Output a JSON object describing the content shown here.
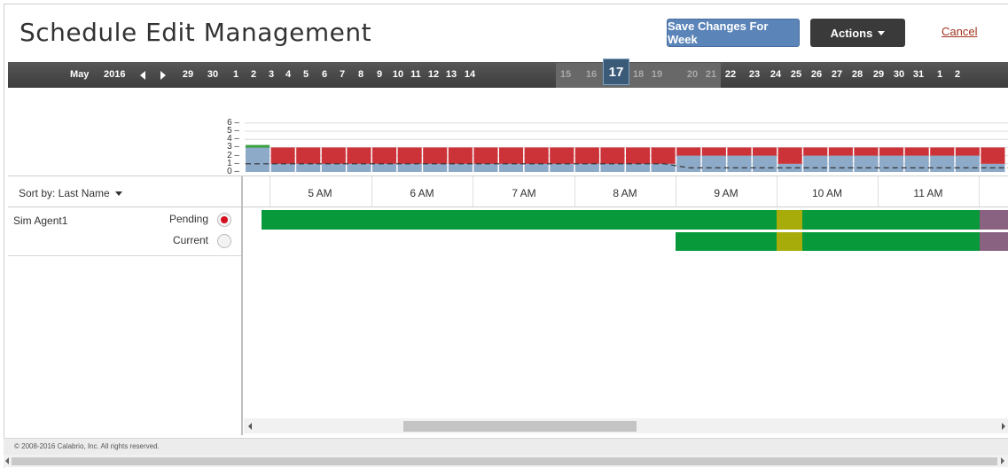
{
  "header": {
    "title": "Schedule Edit Management",
    "save_label": "Save Changes For Week",
    "actions_label": "Actions",
    "cancel_label": "Cancel"
  },
  "date_strip": {
    "month": "May",
    "year": "2016",
    "selected_day": "17",
    "days": [
      "29",
      "30",
      "1",
      "2",
      "3",
      "4",
      "5",
      "6",
      "7",
      "8",
      "9",
      "10",
      "11",
      "12",
      "13",
      "14",
      "15",
      "16",
      "18",
      "19",
      "20",
      "21",
      "22",
      "23",
      "24",
      "25",
      "26",
      "27",
      "28",
      "29",
      "30",
      "31",
      "1",
      "2"
    ],
    "dim_days": [
      "15",
      "16",
      "18",
      "19",
      "20",
      "21"
    ]
  },
  "coverage_chart": {
    "type": "bar",
    "y_ticks": [
      "6",
      "5",
      "4",
      "3",
      "2",
      "1",
      "0"
    ],
    "ylim": [
      0,
      6
    ],
    "bar_count": 30,
    "scheduled_values": [
      3,
      1,
      1,
      1,
      1,
      1,
      1,
      1,
      1,
      1,
      1,
      1,
      1,
      1,
      1,
      1,
      1,
      2,
      2,
      2,
      2,
      1,
      2,
      2,
      2,
      2,
      2,
      2,
      2,
      1
    ],
    "required_values": [
      3,
      3,
      3,
      3,
      3,
      3,
      3,
      3,
      3,
      3,
      3,
      3,
      3,
      3,
      3,
      3,
      3,
      3,
      3,
      3,
      3,
      3,
      3,
      3,
      3,
      3,
      3,
      3,
      3,
      3
    ],
    "over_marker_value": 3.2,
    "trend_line": [
      1,
      1,
      1,
      1,
      1,
      1,
      1,
      1,
      1,
      1,
      1,
      1,
      1,
      1,
      1,
      1,
      1,
      0.5,
      0.5,
      0.5,
      0.5,
      0.5,
      0.5,
      0.5,
      0.5,
      0.5,
      0.5,
      0.5,
      0.5,
      0.5
    ],
    "colors": {
      "scheduled": "#8eaac9",
      "shortfall": "#cc3339",
      "over": "#3aa03e",
      "trend": "#333333"
    }
  },
  "grid": {
    "sort_label": "Sort by: Last Name",
    "hours": [
      "5 AM",
      "6 AM",
      "7 AM",
      "8 AM",
      "9 AM",
      "10 AM",
      "11 AM"
    ]
  },
  "agents": [
    {
      "name": "Sim Agent1",
      "pending_label": "Pending",
      "current_label": "Current",
      "pending_selected": true
    }
  ],
  "schedule_colors": {
    "work": "#07993a",
    "break": "#a7ac0a",
    "other": "#8a6281"
  },
  "footer": {
    "copyright": "© 2008-2016 Calabrio, Inc. All rights reserved."
  }
}
